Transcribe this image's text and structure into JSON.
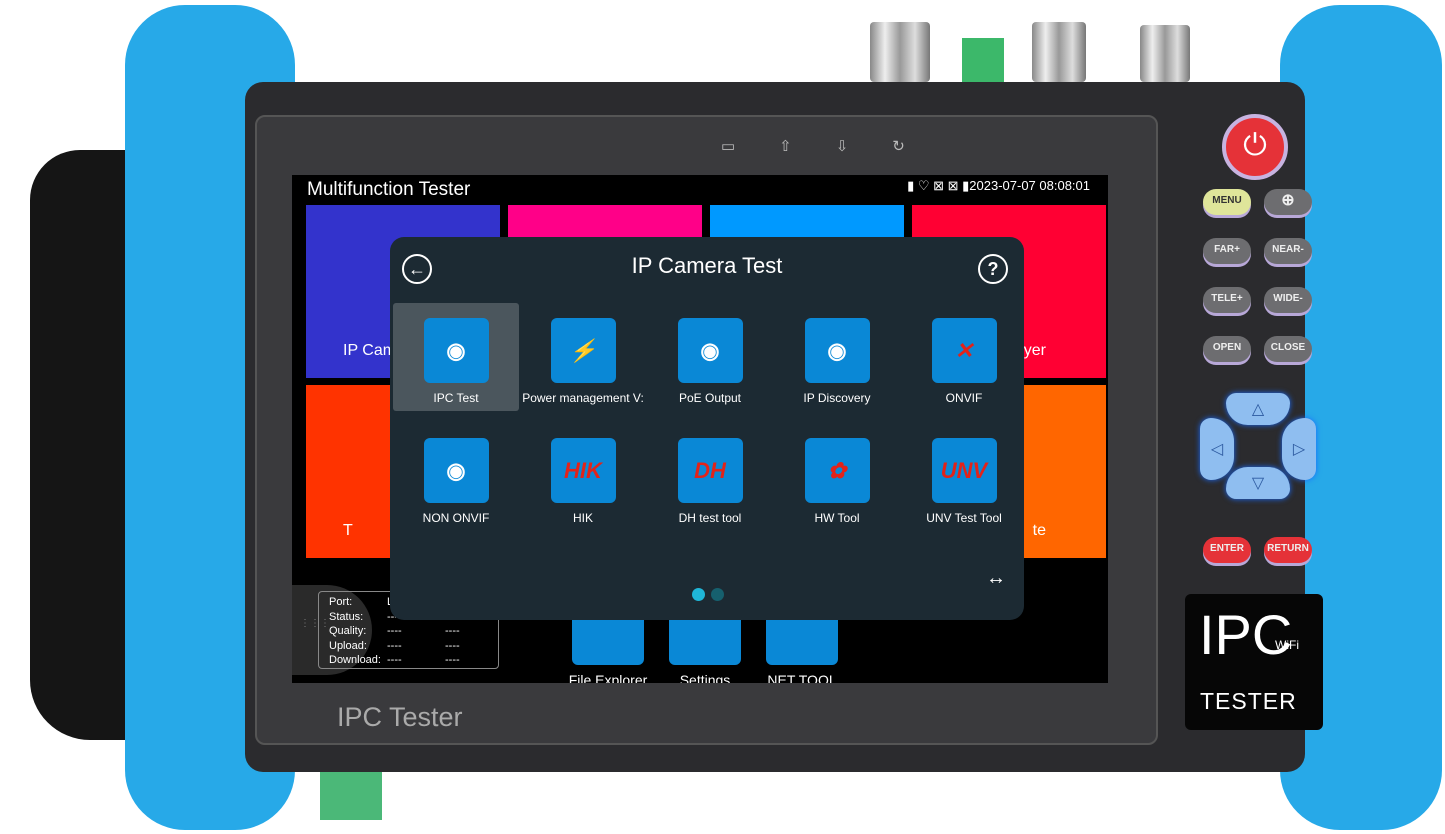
{
  "device": {
    "bezel_label": "IPC Tester",
    "logo_main": "IPC",
    "logo_wifi": "WiFi",
    "logo_sub": "TESTER",
    "buttons": [
      "MENU",
      "FAR+",
      "NEAR-",
      "TELE+",
      "WIDE-",
      "OPEN",
      "CLOSE",
      "ENTER",
      "RETURN"
    ],
    "top_indicator_icons": [
      "battery-charge-icon",
      "home-icon",
      "download-icon",
      "rotate-icon"
    ],
    "colors": {
      "bumper": "#27a9e8",
      "power": "#e53238"
    }
  },
  "screen": {
    "title": "Multifunction Tester",
    "datetime": "2023-07-07 08:08:01",
    "status_icons": [
      "sd-card-icon",
      "wifi-icon",
      "no-monitor-icon",
      "no-monitor-icon",
      "battery-icon"
    ],
    "tiles": [
      {
        "label": "IP Cam",
        "color": "#3333cc"
      },
      {
        "label": "",
        "color": "#ff0088"
      },
      {
        "label": "",
        "color": "#0099ff"
      },
      {
        "label": "layer",
        "color": "#ff0033"
      },
      {
        "label": "T",
        "color": "#ff3300"
      },
      {
        "label": "te",
        "color": "#ff6600"
      }
    ],
    "info": {
      "rows": [
        {
          "k": "Port:",
          "a": "L",
          "b": ""
        },
        {
          "k": "Status:",
          "a": "---",
          "b": ""
        },
        {
          "k": "Quality:",
          "a": "----",
          "b": "----"
        },
        {
          "k": "Upload:",
          "a": "----",
          "b": "----"
        },
        {
          "k": "Download:",
          "a": "----",
          "b": "----"
        }
      ]
    },
    "bottom_apps": [
      {
        "label": "File Explorer"
      },
      {
        "label": "Settings"
      },
      {
        "label": "NET TOOL"
      }
    ]
  },
  "dialog": {
    "title": "IP Camera Test",
    "back": "←",
    "help": "?",
    "page_count": 2,
    "current_page": 1,
    "apps": [
      {
        "label": "IPC Test",
        "icon": "camera-icon",
        "selected": true
      },
      {
        "label": "Power management V:",
        "icon": "power-icon",
        "badge": "⚡"
      },
      {
        "label": "PoE Output",
        "icon": "poe-icon"
      },
      {
        "label": "IP Discovery",
        "icon": "radar-icon"
      },
      {
        "label": "ONVIF",
        "icon": "tools-icon",
        "badge": "✕"
      },
      {
        "label": "NON ONVIF",
        "icon": "camera-icon"
      },
      {
        "label": "HIK",
        "icon": "hik-logo-icon",
        "badge": "HIK"
      },
      {
        "label": "DH test tool",
        "icon": "dh-logo-icon",
        "badge": "DH"
      },
      {
        "label": "HW Tool",
        "icon": "huawei-logo-icon",
        "badge": "✿"
      },
      {
        "label": "UNV Test Tool",
        "icon": "unv-logo-icon",
        "badge": "UNV"
      }
    ]
  }
}
